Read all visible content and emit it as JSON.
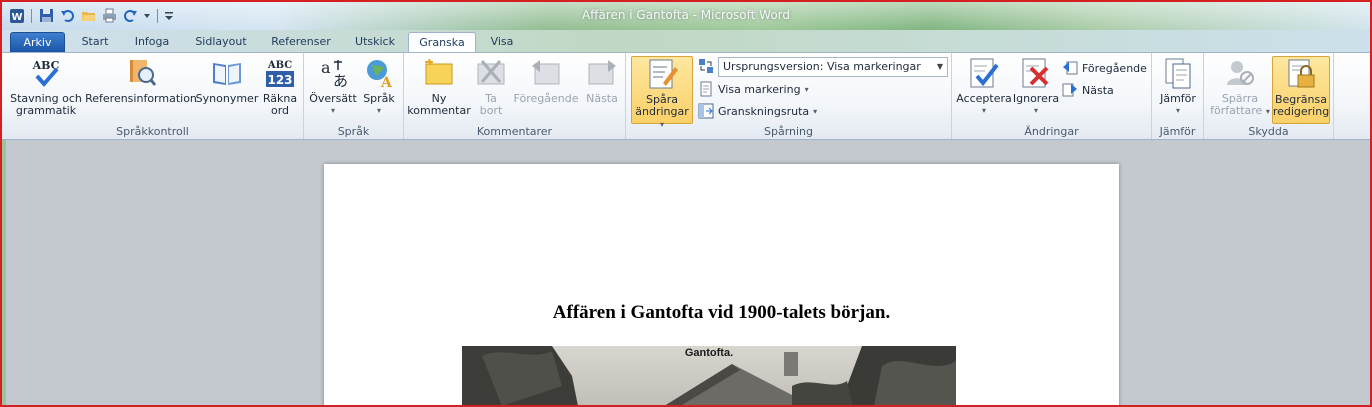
{
  "window": {
    "title": "Affären i Gantofta  -  Microsoft Word"
  },
  "quick_access": [
    "word-logo-icon",
    "save-icon",
    "undo-icon",
    "open-icon",
    "print-icon",
    "redo-icon",
    "qat-customize-icon"
  ],
  "tabs": [
    {
      "label": "Arkiv"
    },
    {
      "label": "Start"
    },
    {
      "label": "Infoga"
    },
    {
      "label": "Sidlayout"
    },
    {
      "label": "Referenser"
    },
    {
      "label": "Utskick"
    },
    {
      "label": "Granska"
    },
    {
      "label": "Visa"
    }
  ],
  "ribbon": {
    "sprakkontroll": {
      "label": "Språkkontroll",
      "stavning": {
        "line1": "Stavning och",
        "line2": "grammatik"
      },
      "referens": {
        "line1": "Referensinformation"
      },
      "synonymer": {
        "line1": "Synonymer"
      },
      "rakna": {
        "line1": "Räkna",
        "line2": "ord"
      },
      "abc_text": "ABC",
      "abc123_top": "ABC",
      "abc123_bottom": "123"
    },
    "sprak": {
      "label": "Språk",
      "oversatt": {
        "line1": "Översätt"
      },
      "sprak_btn": {
        "line1": "Språk"
      }
    },
    "kommentarer": {
      "label": "Kommentarer",
      "ny": {
        "line1": "Ny",
        "line2": "kommentar"
      },
      "ta_bort": {
        "line1": "Ta",
        "line2": "bort"
      },
      "foregaende": {
        "line1": "Föregående"
      },
      "nasta": {
        "line1": "Nästa"
      }
    },
    "sparning": {
      "label": "Spårning",
      "spara": {
        "line1": "Spåra",
        "line2": "ändringar"
      },
      "version_dropdown": "Ursprungsversion: Visa markeringar",
      "visa_markering": "Visa markering",
      "granskningsruta": "Granskningsruta"
    },
    "andringar": {
      "label": "Ändringar",
      "acceptera": {
        "line1": "Acceptera"
      },
      "ignorera": {
        "line1": "Ignorera"
      },
      "foregaende": "Föregående",
      "nasta": "Nästa"
    },
    "jamfor": {
      "label": "Jämför",
      "jamfor_btn": {
        "line1": "Jämför"
      }
    },
    "skydda": {
      "label": "Skydda",
      "sparra": {
        "line1": "Spärra",
        "line2": "författare"
      },
      "begransa": {
        "line1": "Begränsa",
        "line2": "redigering"
      }
    }
  },
  "document": {
    "heading": "Affären i Gantofta  vid 1900-talets början.",
    "photo_caption": "Gantofta."
  }
}
